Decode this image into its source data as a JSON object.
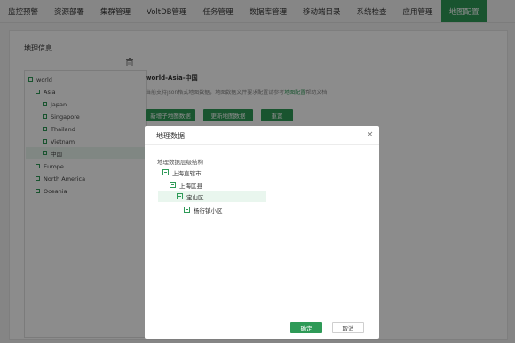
{
  "nav": {
    "tabs": [
      {
        "label": "监控预警"
      },
      {
        "label": "资源部署"
      },
      {
        "label": "集群管理"
      },
      {
        "label": "VoltDB管理"
      },
      {
        "label": "任务管理"
      },
      {
        "label": "数据库管理"
      },
      {
        "label": "移动端目录"
      },
      {
        "label": "系统检查"
      },
      {
        "label": "应用管理"
      },
      {
        "label": "地图配置"
      }
    ],
    "active_index": 9
  },
  "geo": {
    "title": "地理信息",
    "tree": [
      {
        "label": "world"
      },
      {
        "label": "Asia"
      },
      {
        "label": "Japan"
      },
      {
        "label": "Singapore"
      },
      {
        "label": "Thailand"
      },
      {
        "label": "Vietnam"
      },
      {
        "label": "中国"
      },
      {
        "label": "Europe"
      },
      {
        "label": "North America"
      },
      {
        "label": "Oceania"
      }
    ],
    "selected": "中国"
  },
  "detail": {
    "path": "world-Asia-中国",
    "desc_prefix": "当前支持json格式地图数据，地图数据文件要求配置请参考",
    "desc_link": "地图配置",
    "desc_suffix": "帮助文档",
    "buttons": {
      "add_child": "新增子地图数据",
      "update": "更新地图数据",
      "reset": "重置"
    }
  },
  "dialog": {
    "title": "地理数据",
    "close": "×",
    "label": "地理数据层级结构",
    "nodes": [
      {
        "label": "上海直辖市"
      },
      {
        "label": "上海区县"
      },
      {
        "label": "宝山区"
      },
      {
        "label": "杨行镇小区"
      }
    ],
    "ok": "确定",
    "cancel": "取消"
  },
  "colors": {
    "accent": "#2e9a57",
    "overlay": "rgba(0,0,0,0.45)"
  }
}
